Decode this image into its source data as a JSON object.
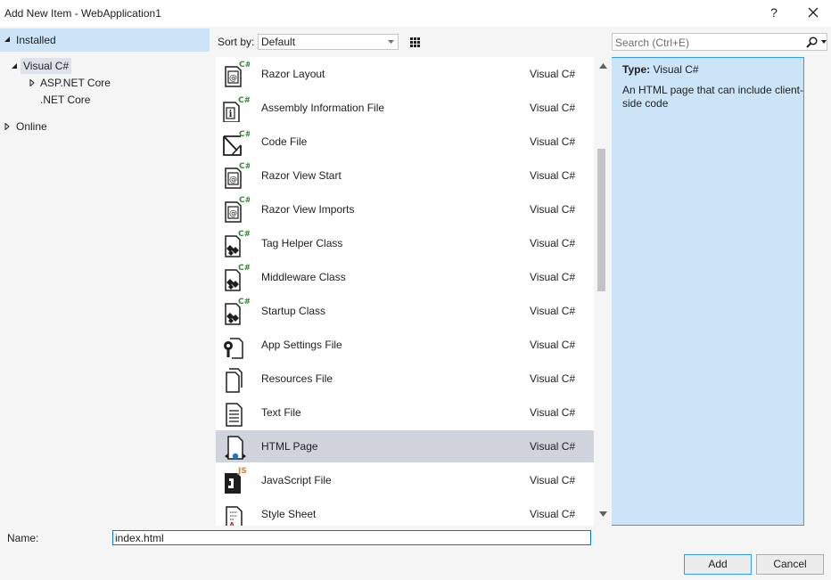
{
  "window": {
    "title": "Add New Item - WebApplication1",
    "help_label": "?"
  },
  "tree": {
    "installed": "Installed",
    "visual_cs": "Visual C#",
    "aspnet_core": "ASP.NET Core",
    "net_core": ".NET Core",
    "online": "Online"
  },
  "toolbar": {
    "sort_label": "Sort by:",
    "sort_value": "Default",
    "search_placeholder": "Search (Ctrl+E)"
  },
  "items": [
    {
      "name": "Razor Layout",
      "lang": "Visual C#",
      "icon": "razor-layout-icon"
    },
    {
      "name": "Assembly Information File",
      "lang": "Visual C#",
      "icon": "assembly-info-icon"
    },
    {
      "name": "Code File",
      "lang": "Visual C#",
      "icon": "code-file-icon"
    },
    {
      "name": "Razor View Start",
      "lang": "Visual C#",
      "icon": "razor-view-start-icon"
    },
    {
      "name": "Razor View Imports",
      "lang": "Visual C#",
      "icon": "razor-view-imports-icon"
    },
    {
      "name": "Tag Helper Class",
      "lang": "Visual C#",
      "icon": "tag-helper-class-icon"
    },
    {
      "name": "Middleware Class",
      "lang": "Visual C#",
      "icon": "middleware-class-icon"
    },
    {
      "name": "Startup Class",
      "lang": "Visual C#",
      "icon": "startup-class-icon"
    },
    {
      "name": "App Settings File",
      "lang": "Visual C#",
      "icon": "app-settings-icon"
    },
    {
      "name": "Resources File",
      "lang": "Visual C#",
      "icon": "resources-file-icon"
    },
    {
      "name": "Text File",
      "lang": "Visual C#",
      "icon": "text-file-icon"
    },
    {
      "name": "HTML Page",
      "lang": "Visual C#",
      "icon": "html-page-icon"
    },
    {
      "name": "JavaScript File",
      "lang": "Visual C#",
      "icon": "javascript-file-icon"
    },
    {
      "name": "Style Sheet",
      "lang": "Visual C#",
      "icon": "style-sheet-icon"
    }
  ],
  "details": {
    "type_label": "Type:",
    "type_value": "Visual C#",
    "description": "An HTML page that can include client-side code"
  },
  "footer": {
    "name_label": "Name:",
    "name_value": "index.html",
    "add_label": "Add",
    "cancel_label": "Cancel"
  },
  "colors": {
    "selection": "#cfd3dc",
    "installed_highlight": "#cce4f7",
    "focus_border": "#007acc",
    "csharp_green": "#388a34",
    "js_orange": "#e37933"
  }
}
